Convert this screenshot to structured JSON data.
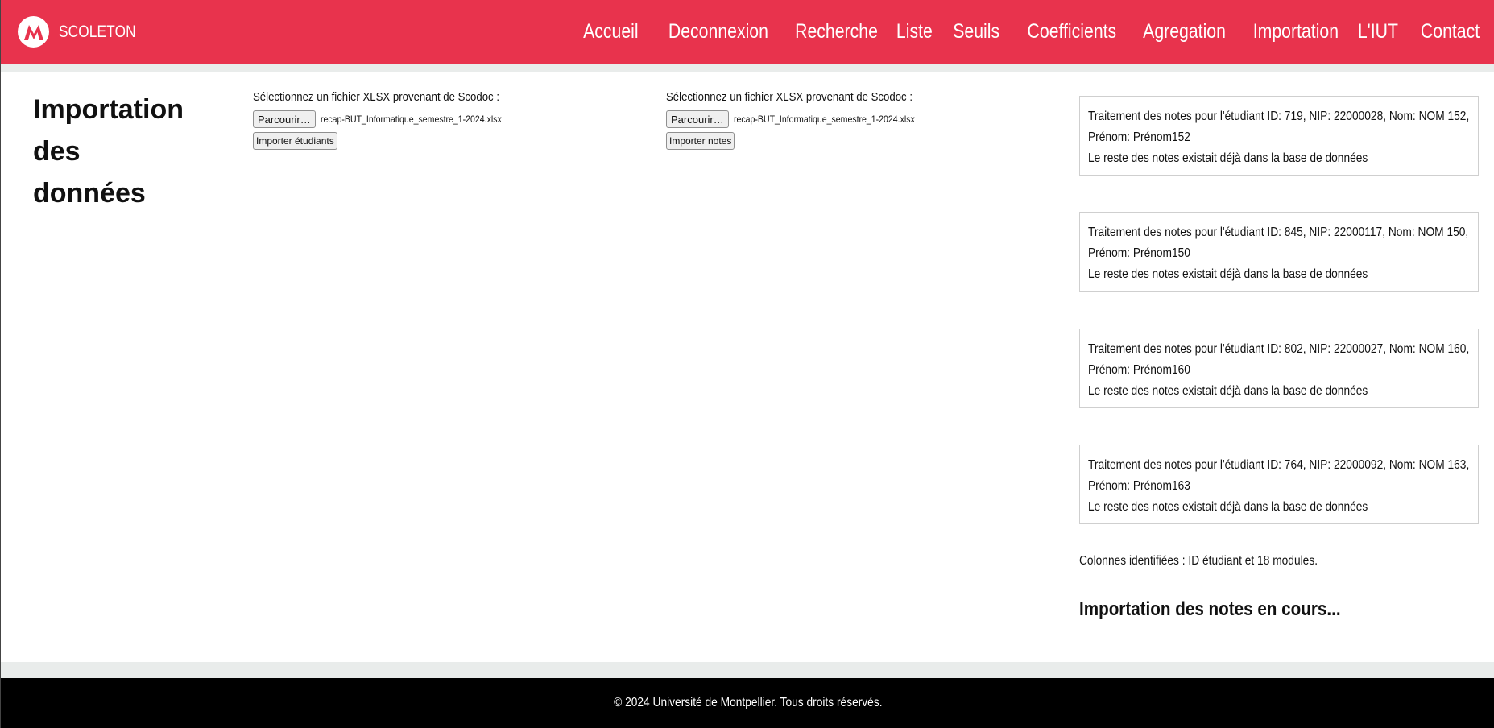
{
  "brand": {
    "name": "SCOLETON",
    "logo_icon": "university-m-logo-icon"
  },
  "colors": {
    "header": "#e8334d",
    "footer": "#000000",
    "strip": "#e9eceb"
  },
  "nav": [
    "Accueil",
    "Deconnexion",
    "Recherche",
    "Liste",
    "Seuils",
    "Coefficients",
    "Agregation",
    "Importation",
    "L'IUT",
    "Contact"
  ],
  "main": {
    "title_line1": "Importation des",
    "title_line2": "données",
    "students_import": {
      "label": "Sélectionnez un fichier XLSX provenant de Scodoc :",
      "browse_label": "Parcourir…",
      "file_name": "recap-BUT_Informatique_semestre_1-2024.xlsx",
      "submit_label": "Importer étudiants"
    },
    "notes_import": {
      "label": "Sélectionnez un fichier XLSX provenant de Scodoc :",
      "browse_label": "Parcourir…",
      "file_name": "recap-BUT_Informatique_semestre_1-2024.xlsx",
      "submit_label": "Importer notes"
    }
  },
  "log": {
    "entries": [
      {
        "line1": "Traitement des notes pour l'étudiant ID: 719, NIP: 22000028, Nom: NOM 152,",
        "line2": "Prénom: Prénom152",
        "line3": "Le reste des notes existait déjà dans la base de données"
      },
      {
        "line1": "Traitement des notes pour l'étudiant ID: 845, NIP: 22000117, Nom: NOM 150,",
        "line2": "Prénom: Prénom150",
        "line3": "Le reste des notes existait déjà dans la base de données"
      },
      {
        "line1": "Traitement des notes pour l'étudiant ID: 802, NIP: 22000027, Nom: NOM 160,",
        "line2": "Prénom: Prénom160",
        "line3": "Le reste des notes existait déjà dans la base de données"
      },
      {
        "line1": "Traitement des notes pour l'étudiant ID: 764, NIP: 22000092, Nom: NOM 163,",
        "line2": "Prénom: Prénom163",
        "line3": "Le reste des notes existait déjà dans la base de données"
      }
    ],
    "columns_info": "Colonnes identifiées : ID étudiant et 18 modules.",
    "status": "Importation des notes en cours..."
  },
  "footer": {
    "text": "© 2024 Université de Montpellier. Tous droits réservés."
  }
}
